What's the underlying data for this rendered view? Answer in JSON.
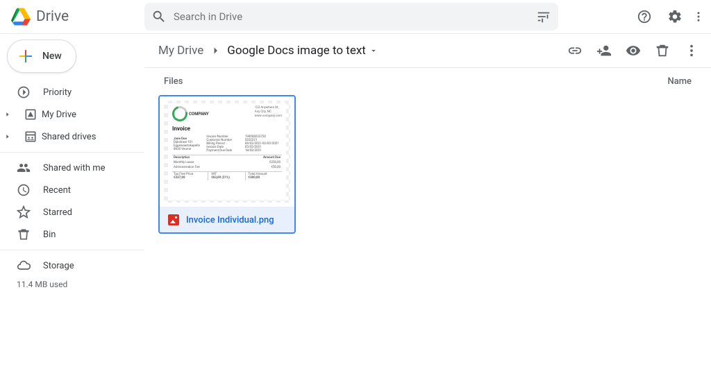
{
  "header": {
    "product": "Drive",
    "search_placeholder": "Search in Drive"
  },
  "new_button": "New",
  "nav": {
    "priority": "Priority",
    "my_drive": "My Drive",
    "shared_drives": "Shared drives",
    "shared_with_me": "Shared with me",
    "recent": "Recent",
    "starred": "Starred",
    "bin": "Bin",
    "storage": "Storage",
    "storage_used": "11.4 MB used"
  },
  "breadcrumb": {
    "root": "My Drive",
    "current": "Google Docs image to text"
  },
  "content": {
    "files_label": "Files",
    "name_label": "Name"
  },
  "file": {
    "name": "Invoice Individual.png",
    "thumb": {
      "company": "COMPANY",
      "addr1": "123 Anywhere St.,",
      "addr2": "Any City, NC",
      "addr3": "www.company.com",
      "title": "Invoice",
      "person": "Jane Doe",
      "street": "Dijkstraat 101",
      "town": "Eggewaartskapelle",
      "zip": "8630 Veurne",
      "f1l": "Invoice Number",
      "f1v": "190008233722",
      "f2l": "Customer Number",
      "f2v": "5222221",
      "f3l": "Billing Period",
      "f3v": "04/02/2021-02/02/2021",
      "f4l": "Invoice Date",
      "f4v": "05/02/2021",
      "f5l": "Payment Due Date",
      "f5v": "18/02/2021",
      "desc_h": "Description",
      "amt_h": "Amount Due",
      "d1l": "Monthly Lease",
      "d1v": "€250,00",
      "d2l": "Administration Fee",
      "d2v": "€50,00",
      "tfp_l": "Tax Free Price",
      "tfp_v": "€237,69",
      "vat_l": "VAT",
      "vat_v": "€63,69 (21%)",
      "tot_l": "Total Amount",
      "tot_v": "€300,00"
    }
  }
}
